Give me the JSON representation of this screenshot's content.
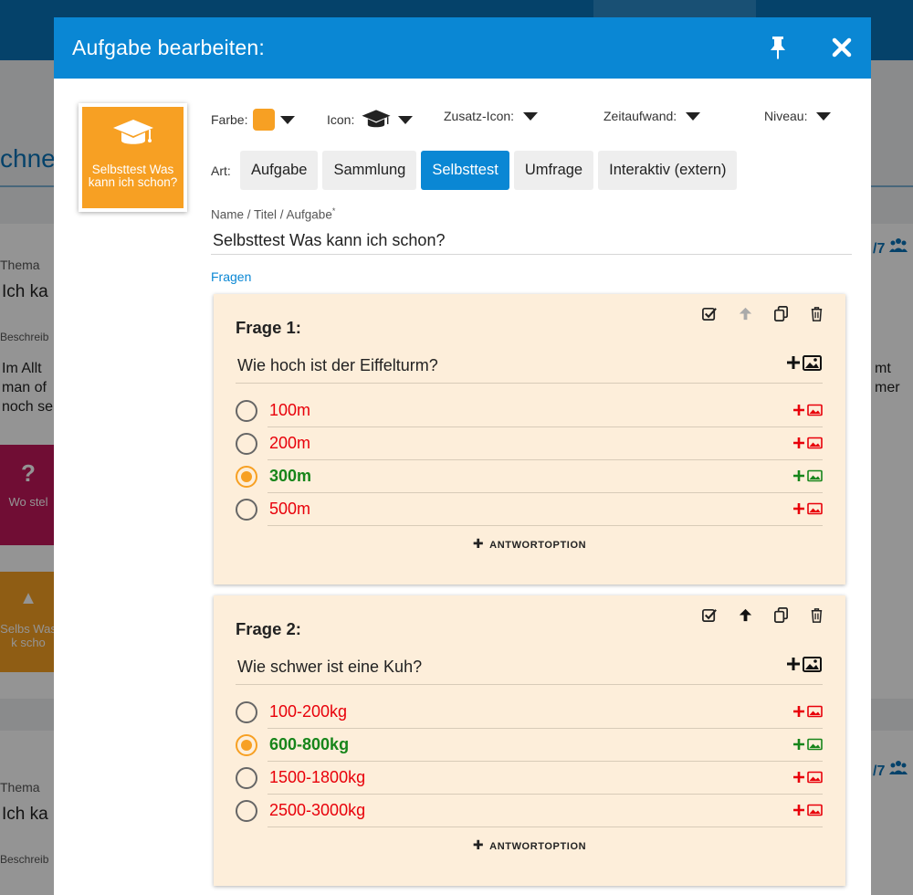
{
  "background": {
    "heading": "chne",
    "cards": [
      {
        "thema_label": "Thema",
        "title": "Ich ka",
        "desc_label": "Beschreib",
        "body": [
          "Im Allt",
          "man of",
          "noch se"
        ],
        "body_right": [
          "mt",
          "mer"
        ],
        "count": "/7"
      },
      {
        "thema_label": "Thema",
        "title": "Ich ka",
        "desc_label": "Beschreib",
        "count": "/7"
      }
    ],
    "tiles": [
      {
        "text": "Wo stel",
        "color": "#c2185b"
      },
      {
        "text": "Selbs Was k scho",
        "color": "#f7a023"
      }
    ]
  },
  "modal": {
    "title": "Aufgabe bearbeiten:",
    "header_color": "#0a87d4",
    "preview": {
      "icon": "graduation-cap-icon",
      "text": "Selbsttest Was kann ich schon?",
      "color": "#f7a023"
    },
    "attributes": {
      "farbe": "Farbe:",
      "icon": "Icon:",
      "zusatz_icon": "Zusatz-Icon:",
      "zeitaufwand": "Zeitaufwand:",
      "niveau": "Niveau:"
    },
    "art": {
      "label": "Art:",
      "options": [
        "Aufgabe",
        "Sammlung",
        "Selbsttest",
        "Umfrage",
        "Interaktiv (extern)"
      ],
      "selected": "Selbsttest"
    },
    "name": {
      "label": "Name / Titel / Aufgabe",
      "required_mark": "*",
      "value": "Selbsttest Was kann ich schon?"
    },
    "fragen_link": "Fragen",
    "add_option_label": "ANTWORTOPTION",
    "questions": [
      {
        "title": "Frage 1:",
        "text": "Wie hoch ist der Eiffelturm?",
        "options": [
          {
            "text": "100m",
            "correct": false
          },
          {
            "text": "200m",
            "correct": false
          },
          {
            "text": "300m",
            "correct": true
          },
          {
            "text": "500m",
            "correct": false
          }
        ]
      },
      {
        "title": "Frage 2:",
        "text": "Wie schwer ist eine Kuh?",
        "options": [
          {
            "text": "100-200kg",
            "correct": false
          },
          {
            "text": "600-800kg",
            "correct": true
          },
          {
            "text": "1500-1800kg",
            "correct": false
          },
          {
            "text": "2500-3000kg",
            "correct": false
          }
        ]
      }
    ]
  },
  "colors": {
    "accent": "#0a87d4",
    "orange": "#f7a023",
    "wrong": "#e8000a",
    "right": "#17851a",
    "card": "#fdeeda"
  }
}
